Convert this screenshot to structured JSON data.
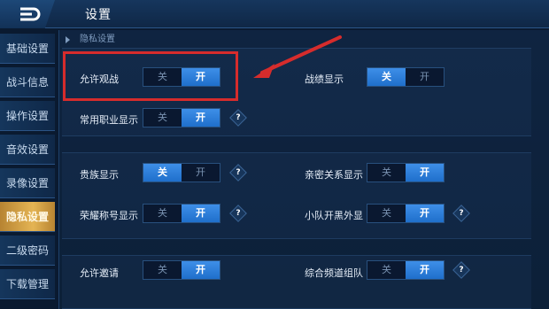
{
  "header": {
    "title": "设置"
  },
  "sidebar": {
    "items": [
      {
        "label": "基础设置"
      },
      {
        "label": "战斗信息"
      },
      {
        "label": "操作设置"
      },
      {
        "label": "音效设置"
      },
      {
        "label": "录像设置"
      },
      {
        "label": "隐私设置",
        "active": true
      },
      {
        "label": "二级密码"
      },
      {
        "label": "下载管理"
      }
    ]
  },
  "section": {
    "title": "隐私设置"
  },
  "settings": [
    {
      "label": "允许观战",
      "off": "关",
      "on": "开",
      "value": "on"
    },
    {
      "label": "战绩显示",
      "off": "关",
      "on": "开",
      "value": "off"
    },
    {
      "label": "常用职业显示",
      "off": "关",
      "on": "开",
      "value": "on",
      "help": "?"
    },
    {
      "label": "贵族显示",
      "off": "关",
      "on": "开",
      "value": "off",
      "help": "?"
    },
    {
      "label": "亲密关系显示",
      "off": "关",
      "on": "开",
      "value": "on"
    },
    {
      "label": "荣耀称号显示",
      "off": "关",
      "on": "开",
      "value": "on",
      "help": "?"
    },
    {
      "label": "小队开黑外显",
      "off": "关",
      "on": "开",
      "value": "on",
      "help": "?"
    },
    {
      "label": "允许邀请",
      "off": "关",
      "on": "开",
      "value": "on"
    },
    {
      "label": "综合频道组队",
      "off": "关",
      "on": "开",
      "value": "on",
      "help": "?"
    }
  ],
  "colors": {
    "accent": "#2f80dc",
    "active_tab": "#e4b454",
    "highlight": "#d62c2c"
  }
}
